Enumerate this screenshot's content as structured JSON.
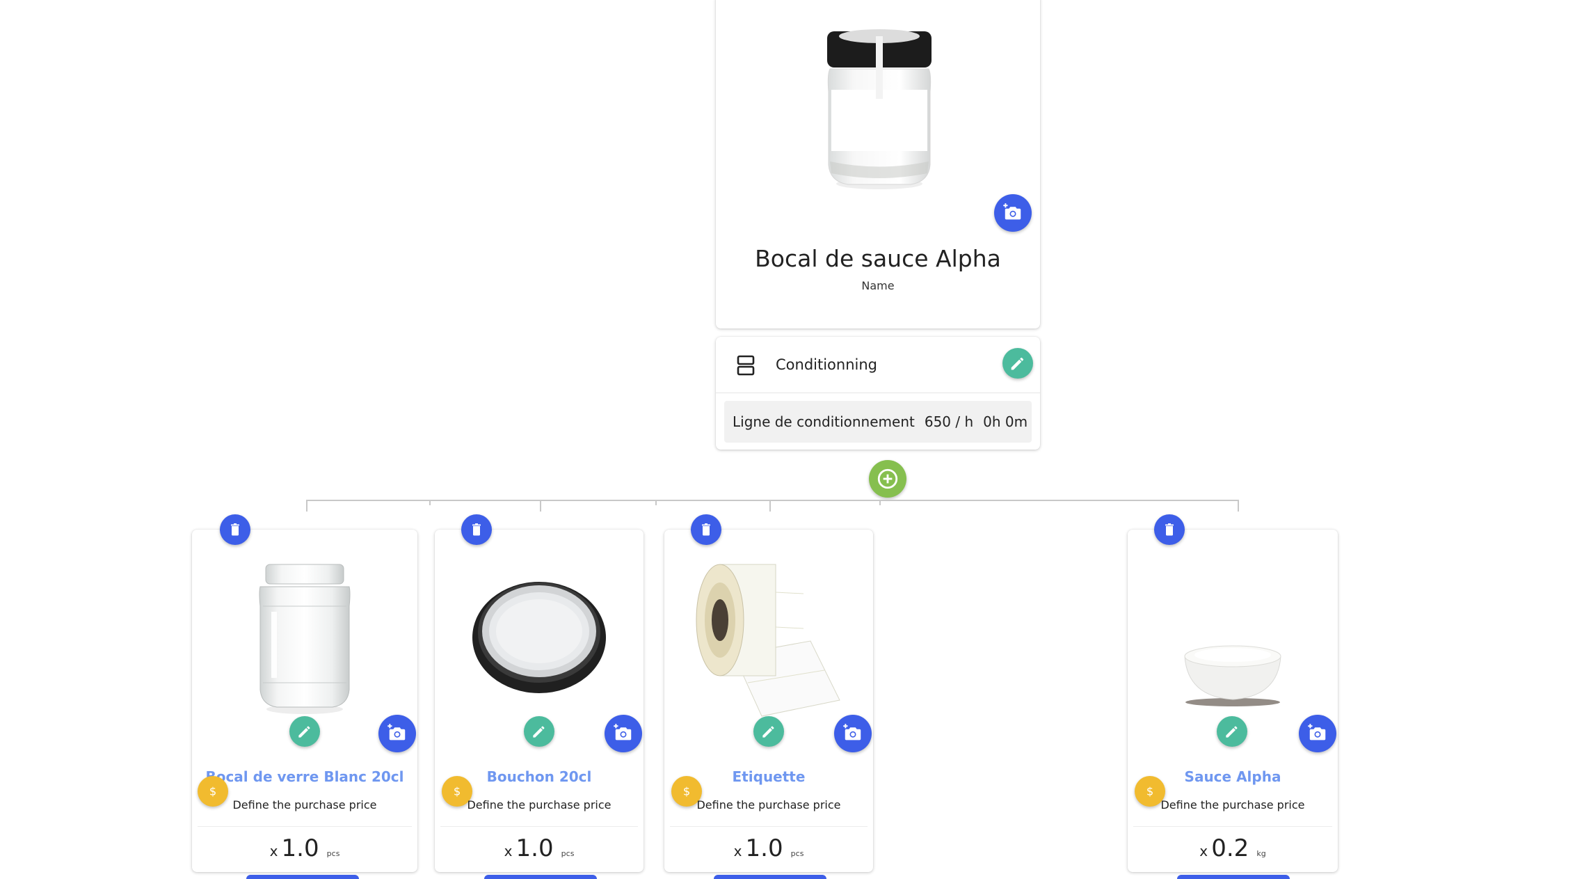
{
  "product": {
    "name": "Bocal de sauce Alpha",
    "name_caption": "Name",
    "image": "sauce-jar-with-black-lid"
  },
  "process": {
    "label": "Conditionning",
    "line": {
      "name": "Ligne de conditionnement",
      "rate": "650 / h",
      "duration": "0h 0m"
    }
  },
  "components": [
    {
      "name": "Bocal de verre Blanc 20cl",
      "price_prompt": "Define the purchase price",
      "qty_prefix": "x",
      "qty": "1.0",
      "unit": "pcs",
      "image": "empty-glass-jar"
    },
    {
      "name": "Bouchon 20cl",
      "price_prompt": "Define the purchase price",
      "qty_prefix": "x",
      "qty": "1.0",
      "unit": "pcs",
      "image": "metal-jar-lid"
    },
    {
      "name": "Etiquette",
      "price_prompt": "Define the purchase price",
      "qty_prefix": "x",
      "qty": "1.0",
      "unit": "pcs",
      "image": "label-roll"
    },
    {
      "name": "Sauce Alpha",
      "price_prompt": "Define the purchase price",
      "qty_prefix": "x",
      "qty": "0.2",
      "unit": "kg",
      "image": "sauce-bowl"
    }
  ],
  "icons": {
    "add_photo": "add-photo-icon",
    "edit": "pencil-icon",
    "delete": "trash-icon",
    "add": "plus-icon",
    "price": "dollar-icon",
    "process": "process-icon"
  },
  "colors": {
    "primary_blue": "#3d5ee8",
    "teal": "#4cbb9d",
    "green": "#86bf4f",
    "gold": "#f1bb2f",
    "component_title": "#6f97f0"
  }
}
